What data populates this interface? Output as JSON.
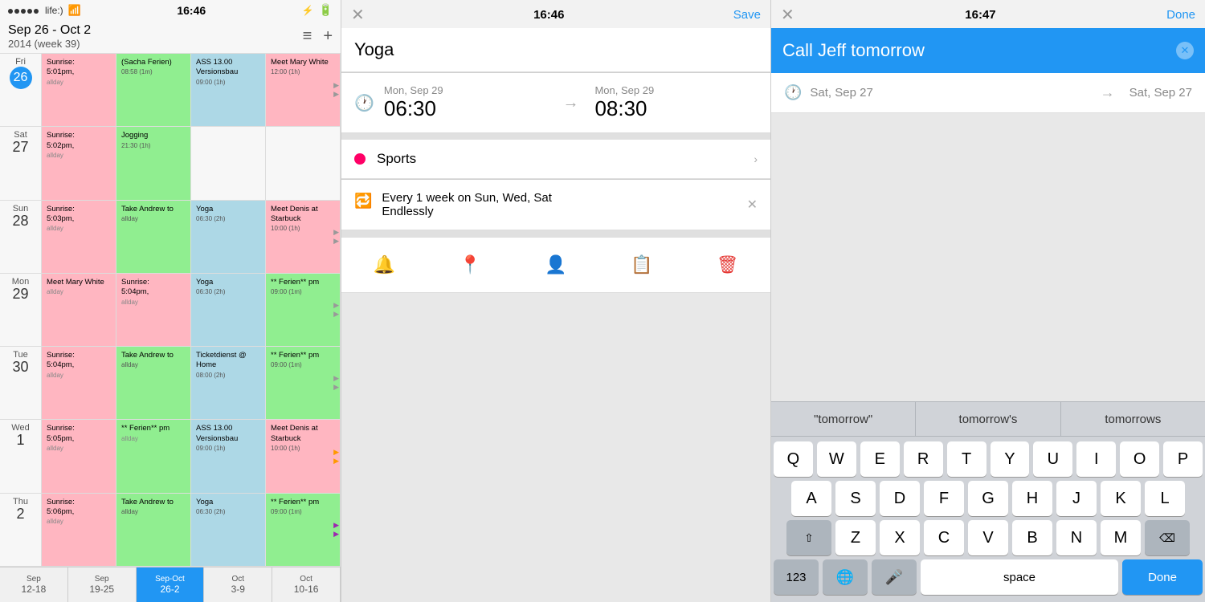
{
  "panel_calendar": {
    "statusbar": {
      "carrier": "life:)",
      "time": "16:46"
    },
    "header": {
      "week_range": "Sep 26 - Oct 2",
      "week_year": "2014 (week 39)",
      "menu_icon": "≡",
      "add_icon": "+"
    },
    "days": [
      {
        "label": "Fri",
        "num": "26",
        "today": true,
        "events": [
          {
            "text": "Sunrise:\n5:01pm,",
            "color": "pink",
            "sub": "allday"
          },
          {
            "text": "(Sacha Ferien)",
            "color": "green",
            "sub": "08:58 (1m)"
          },
          {
            "text": "ASS 13.00 Versionsbau",
            "color": "blue",
            "sub": "09:00 (1h)"
          },
          {
            "text": "Meet Mary White",
            "color": "pink",
            "sub": "12:00 (1h)",
            "arrow": true
          }
        ]
      },
      {
        "label": "Sat",
        "num": "27",
        "today": false,
        "events": [
          {
            "text": "Sunrise:\n5:02pm,",
            "color": "pink",
            "sub": "allday"
          },
          {
            "text": "Jogging",
            "color": "green",
            "sub": "21:30 (1h)"
          },
          {
            "text": "",
            "color": "white",
            "sub": ""
          },
          {
            "text": "",
            "color": "white",
            "sub": ""
          }
        ]
      },
      {
        "label": "Sun",
        "num": "28",
        "today": false,
        "events": [
          {
            "text": "Sunrise:\n5:03pm,",
            "color": "pink",
            "sub": "allday"
          },
          {
            "text": "Take Andrew to",
            "color": "green",
            "sub": "allday"
          },
          {
            "text": "Yoga",
            "color": "blue",
            "sub": "06:30 (2h)"
          },
          {
            "text": "Meet Denis at Starbuck",
            "color": "pink",
            "sub": "10:00 (1h)",
            "arrow": true
          }
        ]
      },
      {
        "label": "Mon",
        "num": "29",
        "today": false,
        "events": [
          {
            "text": "Meet Mary White",
            "color": "pink",
            "sub": "allday"
          },
          {
            "text": "Sunrise:\n5:04pm,",
            "color": "pink",
            "sub": "allday"
          },
          {
            "text": "Yoga",
            "color": "blue",
            "sub": "06:30 (2h)"
          },
          {
            "text": "** Ferien** pm",
            "color": "green",
            "sub": "09:00 (1m)",
            "arrow": true
          }
        ]
      },
      {
        "label": "Tue",
        "num": "30",
        "today": false,
        "events": [
          {
            "text": "Sunrise:\n5:04pm,",
            "color": "pink",
            "sub": "allday"
          },
          {
            "text": "Take Andrew to",
            "color": "green",
            "sub": "allday"
          },
          {
            "text": "Ticketdienst @ Home",
            "color": "blue",
            "sub": "08:00 (2h)"
          },
          {
            "text": "** Ferien** pm",
            "color": "green",
            "sub": "09:00 (1m)",
            "arrow": true
          }
        ]
      },
      {
        "label": "Wed",
        "num": "1",
        "today": false,
        "events": [
          {
            "text": "Sunrise:\n5:05pm,",
            "color": "pink",
            "sub": "allday"
          },
          {
            "text": "** Ferien** pm",
            "color": "green",
            "sub": "allday"
          },
          {
            "text": "ASS 13.00 Versionsbau",
            "color": "blue",
            "sub": "09:00 (1h)"
          },
          {
            "text": "Meet Denis at Starbuck",
            "color": "pink",
            "sub": "10:00 (1h)",
            "arrow": true
          }
        ]
      },
      {
        "label": "Thu",
        "num": "2",
        "today": false,
        "events": [
          {
            "text": "Sunrise:\n5:06pm,",
            "color": "pink",
            "sub": "allday"
          },
          {
            "text": "Take Andrew to",
            "color": "green",
            "sub": "allday"
          },
          {
            "text": "Yoga",
            "color": "blue",
            "sub": "06:30 (2h)"
          },
          {
            "text": "** Ferien** pm",
            "color": "green",
            "sub": "09:00 (1m)",
            "arrow": true
          }
        ]
      }
    ],
    "week_tabs": [
      {
        "label": "Sep",
        "dates": "12-18",
        "active": false
      },
      {
        "label": "Sep",
        "dates": "19-25",
        "active": false
      },
      {
        "label": "Sep-Oct",
        "dates": "26-2",
        "active": true
      },
      {
        "label": "Oct",
        "dates": "3-9",
        "active": false
      },
      {
        "label": "Oct",
        "dates": "10-16",
        "active": false
      }
    ]
  },
  "panel_event": {
    "statusbar": {
      "time": "16:46",
      "save_label": "Save"
    },
    "title": "Yoga",
    "start_date": "Mon, Sep 29",
    "start_time": "06:30",
    "end_date": "Mon, Sep 29",
    "end_time": "08:30",
    "calendar_name": "Sports",
    "calendar_dot_color": "#f06",
    "repeat_freq": "Every 1 week on Sun, Wed, Sat",
    "repeat_end": "Endlessly",
    "toolbar": {
      "alarm_icon": "🔔",
      "location_icon": "📍",
      "person_icon": "👤",
      "notes_icon": "📋",
      "delete_icon": "🗑"
    }
  },
  "panel_reminder": {
    "statusbar": {
      "time": "16:47",
      "done_label": "Done"
    },
    "input_text": "Call Jeff tomorrow",
    "start_date": "Sat, Sep 27",
    "end_date": "Sat, Sep 27",
    "autocomplete": [
      {
        "label": "\"tomorrow\""
      },
      {
        "label": "tomorrow's"
      },
      {
        "label": "tomorrows"
      }
    ],
    "keyboard": {
      "row1": [
        "Q",
        "W",
        "E",
        "R",
        "T",
        "Y",
        "U",
        "I",
        "O",
        "P"
      ],
      "row2": [
        "A",
        "S",
        "D",
        "F",
        "G",
        "H",
        "J",
        "K",
        "L"
      ],
      "row3": [
        "Z",
        "X",
        "C",
        "V",
        "B",
        "N",
        "M"
      ],
      "shift_icon": "⇧",
      "backspace_icon": "⌫",
      "num_label": "123",
      "globe_label": "🌐",
      "mic_label": "🎤",
      "space_label": "space",
      "done_label": "Done"
    }
  }
}
